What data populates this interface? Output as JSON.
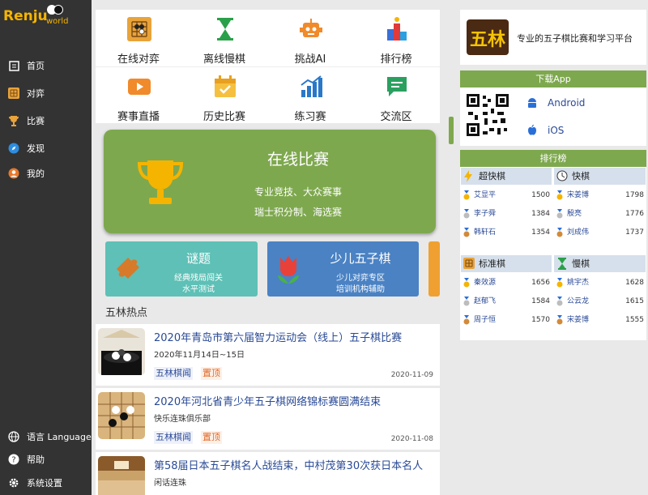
{
  "app": {
    "logo_text": "Renju",
    "logo_sub": "world"
  },
  "sidebar": {
    "items": [
      {
        "label": "首页",
        "icon": "home-icon"
      },
      {
        "label": "对弈",
        "icon": "board-icon"
      },
      {
        "label": "比赛",
        "icon": "trophy-icon"
      },
      {
        "label": "发现",
        "icon": "compass-icon"
      },
      {
        "label": "我的",
        "icon": "user-icon"
      }
    ],
    "bottom": [
      {
        "label": "语言 Language",
        "icon": "globe-icon"
      },
      {
        "label": "帮助",
        "icon": "help-icon"
      },
      {
        "label": "系统设置",
        "icon": "gear-icon"
      }
    ]
  },
  "grid": {
    "items": [
      {
        "label": "在线对弈",
        "icon": "gomoku-board-icon"
      },
      {
        "label": "离线慢棋",
        "icon": "hourglass-icon"
      },
      {
        "label": "挑战AI",
        "icon": "robot-icon"
      },
      {
        "label": "排行榜",
        "icon": "podium-icon"
      },
      {
        "label": "赛事直播",
        "icon": "video-icon"
      },
      {
        "label": "历史比赛",
        "icon": "calendar-icon"
      },
      {
        "label": "练习赛",
        "icon": "bar-chart-icon"
      },
      {
        "label": "交流区",
        "icon": "chat-icon"
      }
    ]
  },
  "banner": {
    "title": "在线比赛",
    "line1": "专业竞技、大众赛事",
    "line2": "瑞士积分制、海选赛",
    "color": "#7ea84e"
  },
  "cards": [
    {
      "title": "谜题",
      "line1": "经典残局闯关",
      "line2": "水平测试",
      "color": "#5ec0b6"
    },
    {
      "title": "少儿五子棋",
      "line1": "少儿对弈专区",
      "line2": "培训机构辅助",
      "color": "#4a82c4"
    }
  ],
  "hot": {
    "title": "五林热点",
    "news": [
      {
        "title": "2020年青岛市第六届智力运动会（线上）五子棋比赛",
        "desc": "2020年11月14日~15日",
        "tag1": "五林棋闻",
        "tag2": "置顶",
        "date": "2020-11-09"
      },
      {
        "title": "2020年河北省青少年五子棋网络锦标赛圆满结束",
        "desc": "快乐连珠俱乐部",
        "tag1": "五林棋闻",
        "tag2": "置顶",
        "date": "2020-11-08"
      },
      {
        "title": "第58届日本五子棋名人战结束，中村茂第30次获日本名人",
        "desc": "闲话连珠",
        "tag1": "",
        "tag2": "",
        "date": ""
      }
    ]
  },
  "right": {
    "slogan": "专业的五子棋比赛和学习平台",
    "logo_text": "五林",
    "download": {
      "head": "下载App",
      "android": "Android",
      "ios": "iOS"
    },
    "rank": {
      "head": "排行榜",
      "groups": [
        {
          "title": "超快棋",
          "icon": "lightning-icon",
          "rows": [
            {
              "name": "艾显平",
              "score": "1500"
            },
            {
              "name": "李子舜",
              "score": "1384"
            },
            {
              "name": "韩轩石",
              "score": "1354"
            }
          ]
        },
        {
          "title": "快棋",
          "icon": "clock-icon",
          "rows": [
            {
              "name": "宋姜博",
              "score": "1798"
            },
            {
              "name": "殷亮",
              "score": "1776"
            },
            {
              "name": "刘成伟",
              "score": "1737"
            }
          ]
        },
        {
          "title": "标准棋",
          "icon": "board-icon",
          "rows": [
            {
              "name": "秦效源",
              "score": "1656"
            },
            {
              "name": "赵郁飞",
              "score": "1584"
            },
            {
              "name": "周子恒",
              "score": "1570"
            }
          ]
        },
        {
          "title": "慢棋",
          "icon": "hourglass-icon",
          "rows": [
            {
              "name": "姚宇杰",
              "score": "1628"
            },
            {
              "name": "公云龙",
              "score": "1615"
            },
            {
              "name": "宋姜博",
              "score": "1555"
            }
          ]
        }
      ]
    }
  },
  "colors": {
    "accent": "#7ea84e",
    "sidebar": "#333333",
    "link": "#2a4a96"
  }
}
